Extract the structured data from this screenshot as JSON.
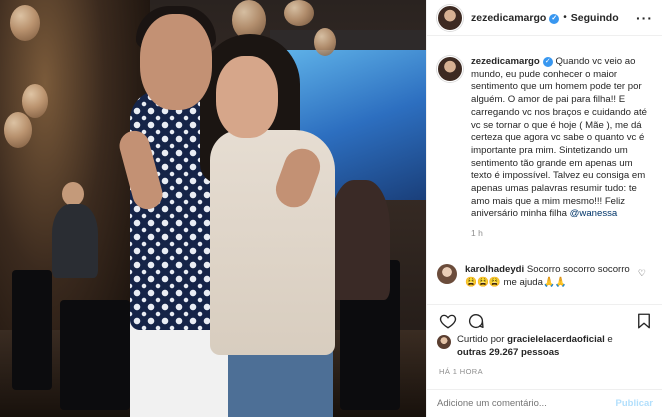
{
  "post": {
    "username": "zezedicamargo",
    "follow_status": "Seguindo",
    "more_icon": "ellipsis",
    "verified_icon": "verified-badge-icon",
    "caption": {
      "username": "zezedicamargo",
      "text": "Quando vc veio ao mundo, eu pude conhecer o maior sentimento que um homem pode ter por alguém. O amor de pai para filha!! E carregando vc nos braços e cuidando até vc se tornar o que é hoje ( Mãe ), me dá certeza que agora vc sabe o quanto vc é importante pra mim. Sintetizando um sentimento tão grande em apenas um texto é impossível. Talvez eu consiga em apenas umas palavras resumir tudo: te amo mais que a mim mesmo!!! Feliz aniversário minha filha",
      "mention": "@wanessa",
      "age": "1 h"
    },
    "comment": {
      "username": "karolhadeydi",
      "text": "Socorro socorro socorro😩😩😩 me ajuda🙏🙏"
    },
    "likes": {
      "prefix": "Curtido por",
      "user": "gracielelacerdaoficial",
      "connector": "e",
      "others": "outras 29.267 pessoas"
    },
    "timestamp": "HÁ 1 HORA",
    "add_comment_placeholder": "Adicione um comentário...",
    "publish_label": "Publicar"
  },
  "colors": {
    "verified": "#3897f0",
    "link": "#003569",
    "muted": "#8e8e8e",
    "publish_disabled": "#b2dffc"
  }
}
